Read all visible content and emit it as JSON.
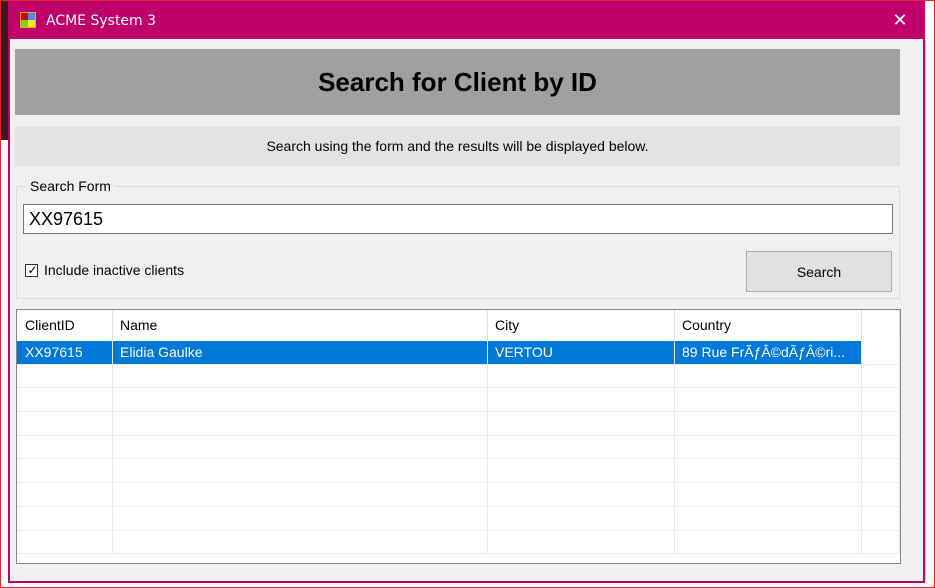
{
  "window": {
    "title": "ACME System 3",
    "close_symbol": "✕",
    "accent_color": "#c0006a"
  },
  "header": {
    "title": "Search for Client by ID"
  },
  "info": {
    "text": "Search using the form and the results will be displayed below."
  },
  "search_form": {
    "legend": "Search Form",
    "input_value": "XX97615",
    "include_inactive_label": "Include inactive clients",
    "include_inactive_checked": true,
    "search_button_label": "Search"
  },
  "results": {
    "columns": [
      "ClientID",
      "Name",
      "City",
      "Country"
    ],
    "rows": [
      {
        "client_id": "XX97615",
        "name": "Elidia Gaulke",
        "city": "VERTOU",
        "country": "89 Rue FrÃƒÂ©dÃƒÂ©ri..."
      }
    ],
    "selection_color": "#0078d7"
  },
  "icons": {
    "app": "app-window-icon",
    "close": "close-icon",
    "checkbox": "checkmark-icon"
  }
}
